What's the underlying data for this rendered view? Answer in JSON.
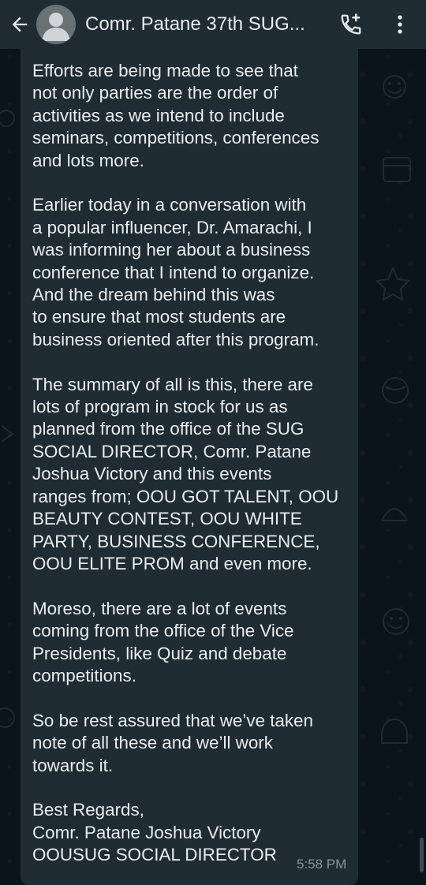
{
  "header": {
    "title": "Comr. Patane 37th SUG...",
    "back_icon": "arrow-left-icon",
    "avatar_icon": "default-person-avatar-icon",
    "call_icon": "phone-add-icon",
    "menu_icon": "more-vertical-icon"
  },
  "message": {
    "paragraphs": [
      [
        "Efforts are being made to see that",
        "not only parties are the order of",
        "activities as we intend to include",
        "seminars, competitions, conferences",
        "and lots more."
      ],
      [
        "Earlier today in a conversation with",
        "a popular influencer, Dr. Amarachi, I",
        "was informing her about a business",
        "conference that I intend to organize.",
        "And the dream behind this was",
        "to ensure that most students are",
        "business oriented after this program."
      ],
      [
        "The summary of all is this, there are",
        "lots of program in stock for us as",
        "planned from the office of the SUG",
        "SOCIAL DIRECTOR, Comr. Patane",
        "Joshua Victory and this events",
        "ranges from; OOU GOT TALENT, OOU",
        "BEAUTY CONTEST, OOU WHITE",
        "PARTY, BUSINESS CONFERENCE,",
        "OOU ELITE PROM and even more."
      ],
      [
        "Moreso, there are a lot of events",
        "coming from the office of the Vice",
        "Presidents, like Quiz and debate",
        "competitions."
      ],
      [
        "So be rest assured that we’ve taken",
        "note of all these and we’ll work",
        "towards it."
      ],
      [
        "Best Regards,",
        "Comr. Patane Joshua Victory",
        "OOUSUG SOCIAL DIRECTOR"
      ]
    ],
    "time": "5:58 PM"
  },
  "colors": {
    "header_bg": "#1f2c34",
    "chat_bg": "#0b141a",
    "bubble_bg": "#202c33",
    "text": "#e9edef",
    "meta": "#8696a0"
  }
}
